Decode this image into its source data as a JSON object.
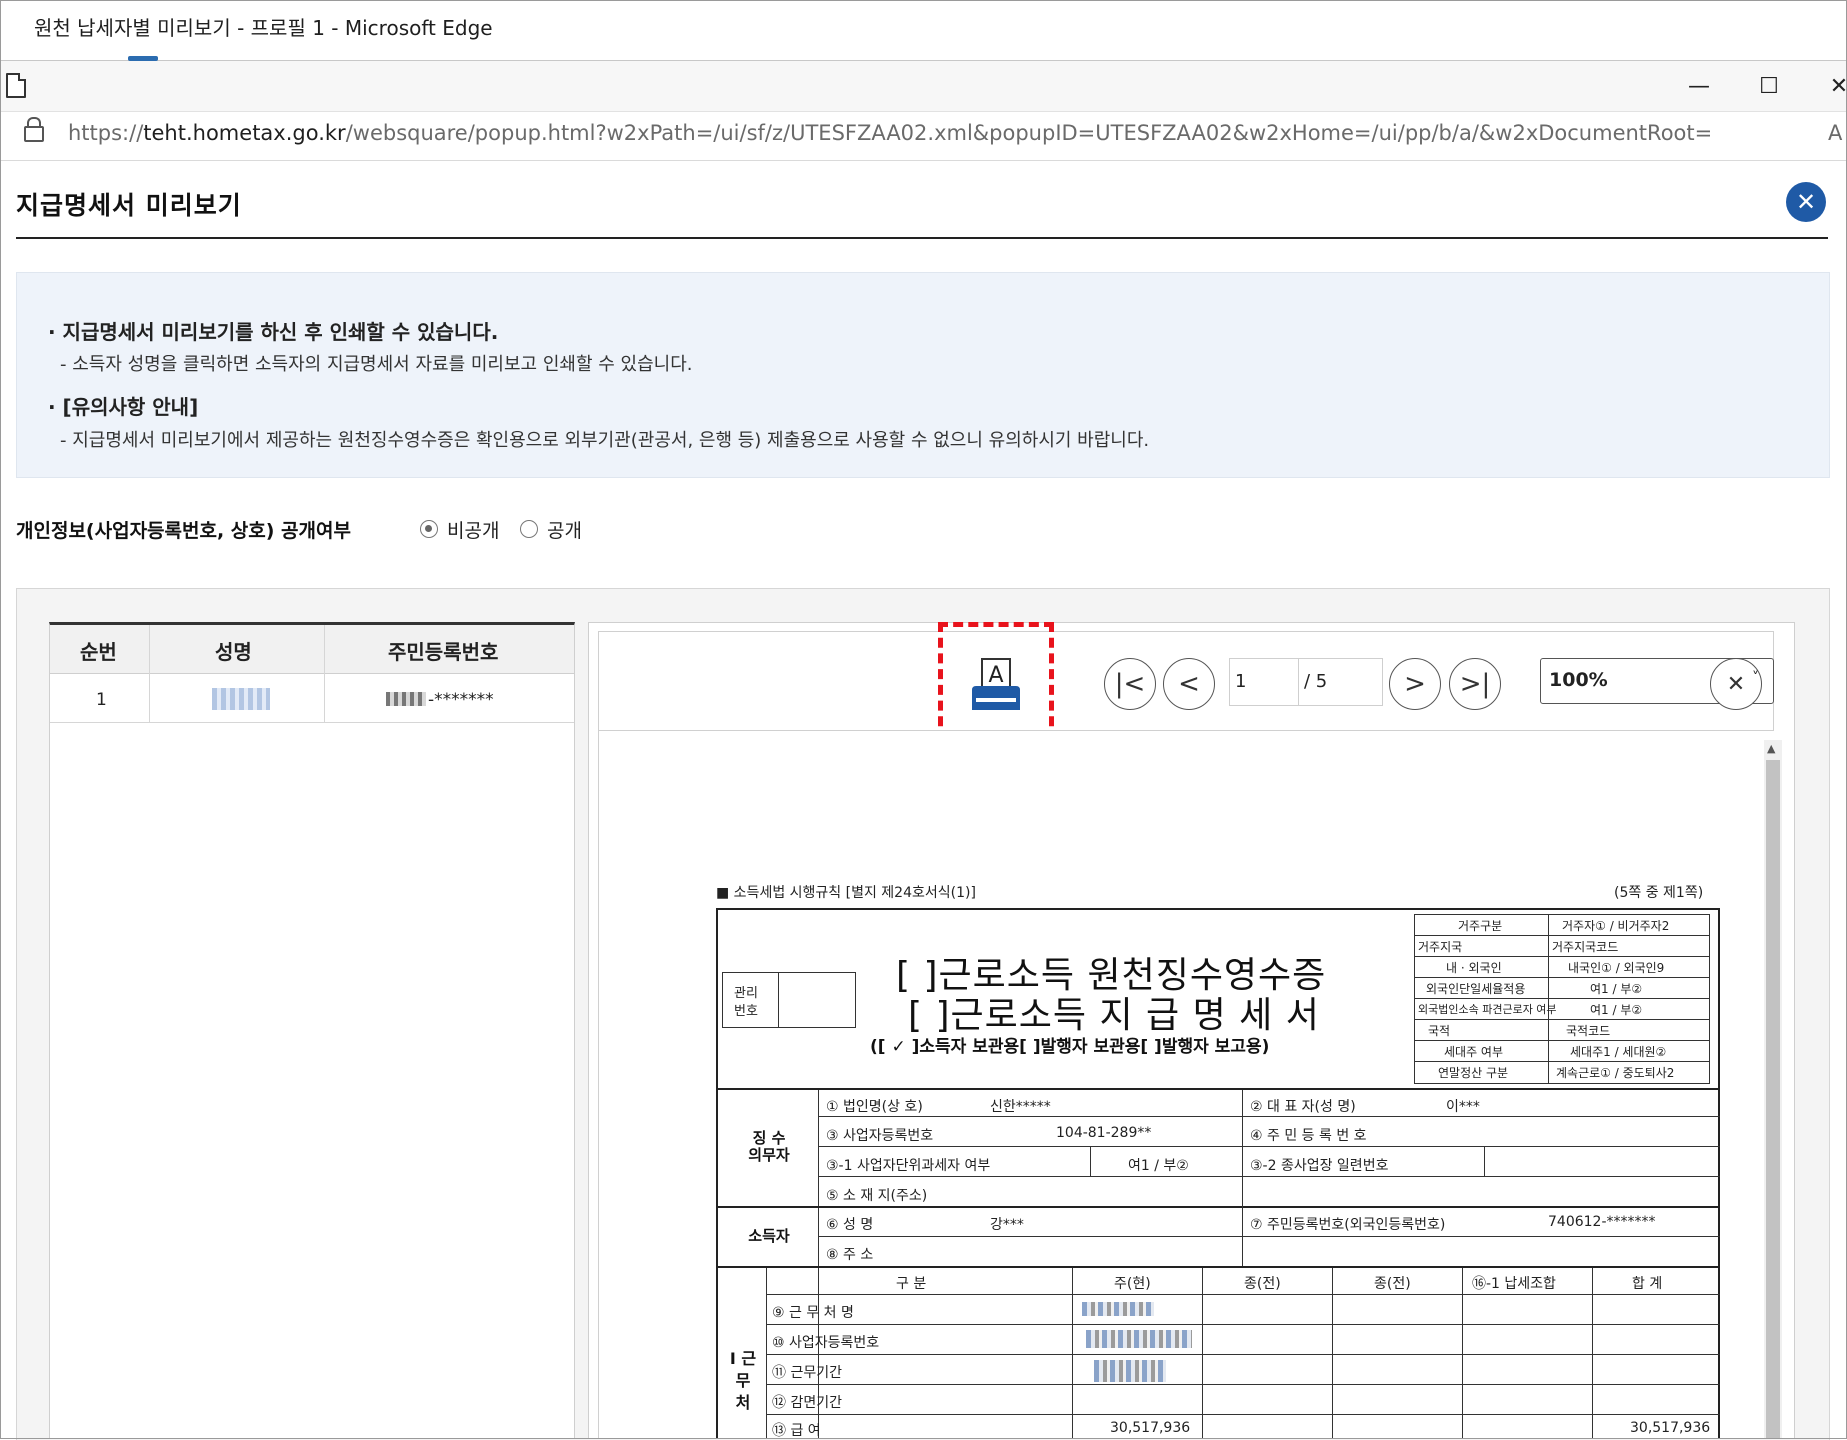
{
  "window": {
    "title": "원천 납세자별 미리보기 - 프로필 1 - Microsoft Edge",
    "url_prefix": "https://",
    "url_host": "teht.hometax.go.kr",
    "url_path": "/websquare/popup.html?w2xPath=/ui/sf/z/UTESFZAA02.xml&popupID=UTESFZAA02&w2xHome=/ui/pp/b/a/&w2xDocumentRoot=",
    "url_overflow": "A",
    "minimize": "—",
    "maximize": "☐",
    "close": "✕"
  },
  "popup": {
    "title": "지급명세서 미리보기",
    "close_icon": "✕"
  },
  "info": {
    "bullet1": "· 지급명세서 미리보기를 하신 후 인쇄할 수 있습니다.",
    "sub1": "- 소득자 성명을 클릭하면 소득자의 지급명세서 자료를 미리보고 인쇄할 수 있습니다.",
    "bullet2": "· [유의사항 안내]",
    "sub2": "- 지급명세서 미리보기에서 제공하는 원천징수영수증은 확인용으로 외부기관(관공서, 은행 등) 제출용으로 사용할 수 없으니 유의하시기 바랍니다."
  },
  "privacy": {
    "label": "개인정보(사업자등록번호, 상호) 공개여부",
    "options": [
      "비공개",
      "공개"
    ],
    "selected": "비공개"
  },
  "list": {
    "headers": [
      "순번",
      "성명",
      "주민등록번호"
    ],
    "rows": [
      {
        "no": "1",
        "id_suffix": "-*******"
      }
    ]
  },
  "viewer": {
    "page_current": "1",
    "page_total": "/ 5",
    "zoom": "100%",
    "first_icon": "|<",
    "prev_icon": "<",
    "next_icon": ">",
    "last_icon": ">|",
    "clear_icon": "✕",
    "caret": "˅"
  },
  "document": {
    "law_ref": "■ 소득세법 시행규칙 [별지 제24호서식(1)]",
    "page_ref": "(5쪽 중 제1쪽)",
    "mgmt_label_1": "관리",
    "mgmt_label_2": "번호",
    "title1": "[  ]근로소득 원천징수영수증",
    "title2": "[  ]근로소득 지 급 명 세 서",
    "copy_type": "([ ✓ ]소득자 보관용[     ]발행자 보관용[     ]발행자 보고용)",
    "meta": [
      [
        "거주구분",
        "거주자① / 비거주자2"
      ],
      [
        "거주지국",
        "거주지국코드"
      ],
      [
        "내 · 외국인",
        "내국인① / 외국인9"
      ],
      [
        "외국인단일세율적용",
        "여1 / 부②"
      ],
      [
        "외국법인소속 파견근로자 여부",
        "여1 / 부②"
      ],
      [
        "국적",
        "국적코드"
      ],
      [
        "세대주 여부",
        "세대주1 / 세대원②"
      ],
      [
        "연말정산 구분",
        "계속근로① / 중도퇴사2"
      ]
    ],
    "payer_label_1": "징 수",
    "payer_label_2": "의무자",
    "f1_label": "① 법인명(상  호)",
    "f1_value": "신한*****",
    "f2_label": "② 대 표 자(성  명)",
    "f2_value": "이***",
    "f3_label": "③ 사업자등록번호",
    "f3_value": "104-81-289**",
    "f4_label": "④ 주 민 등 록 번 호",
    "f3_1_label": "③-1 사업자단위과세자 여부",
    "f3_1_value": "여1 / 부②",
    "f3_2_label": "③-2 종사업장 일련번호",
    "f5_label": "⑤ 소 재 지(주소)",
    "earner_label": "소득자",
    "f6_label": "⑥ 성        명",
    "f6_value": "강***",
    "f7_label": "⑦ 주민등록번호(외국인등록번호)",
    "f7_value": "740612-*******",
    "f8_label": "⑧ 주        소",
    "work_label": "Ⅰ 근 무 처",
    "grid_headers": [
      "구    분",
      "주(현)",
      "종(전)",
      "종(전)",
      "⑯-1 납세조합",
      "합  계"
    ],
    "grid_rows": [
      "⑨ 근  무  처  명",
      "⑩ 사업자등록번호",
      "⑪ 근무기간",
      "⑫ 감면기간",
      "⑬ 급        여"
    ],
    "salary_main": "30,517,936",
    "salary_total": "30,517,936"
  },
  "colors": {
    "accent": "#1f5aa6",
    "highlight": "#e8131c",
    "info_bg": "#eef3fa",
    "print_icon": "#1f5aa6"
  }
}
